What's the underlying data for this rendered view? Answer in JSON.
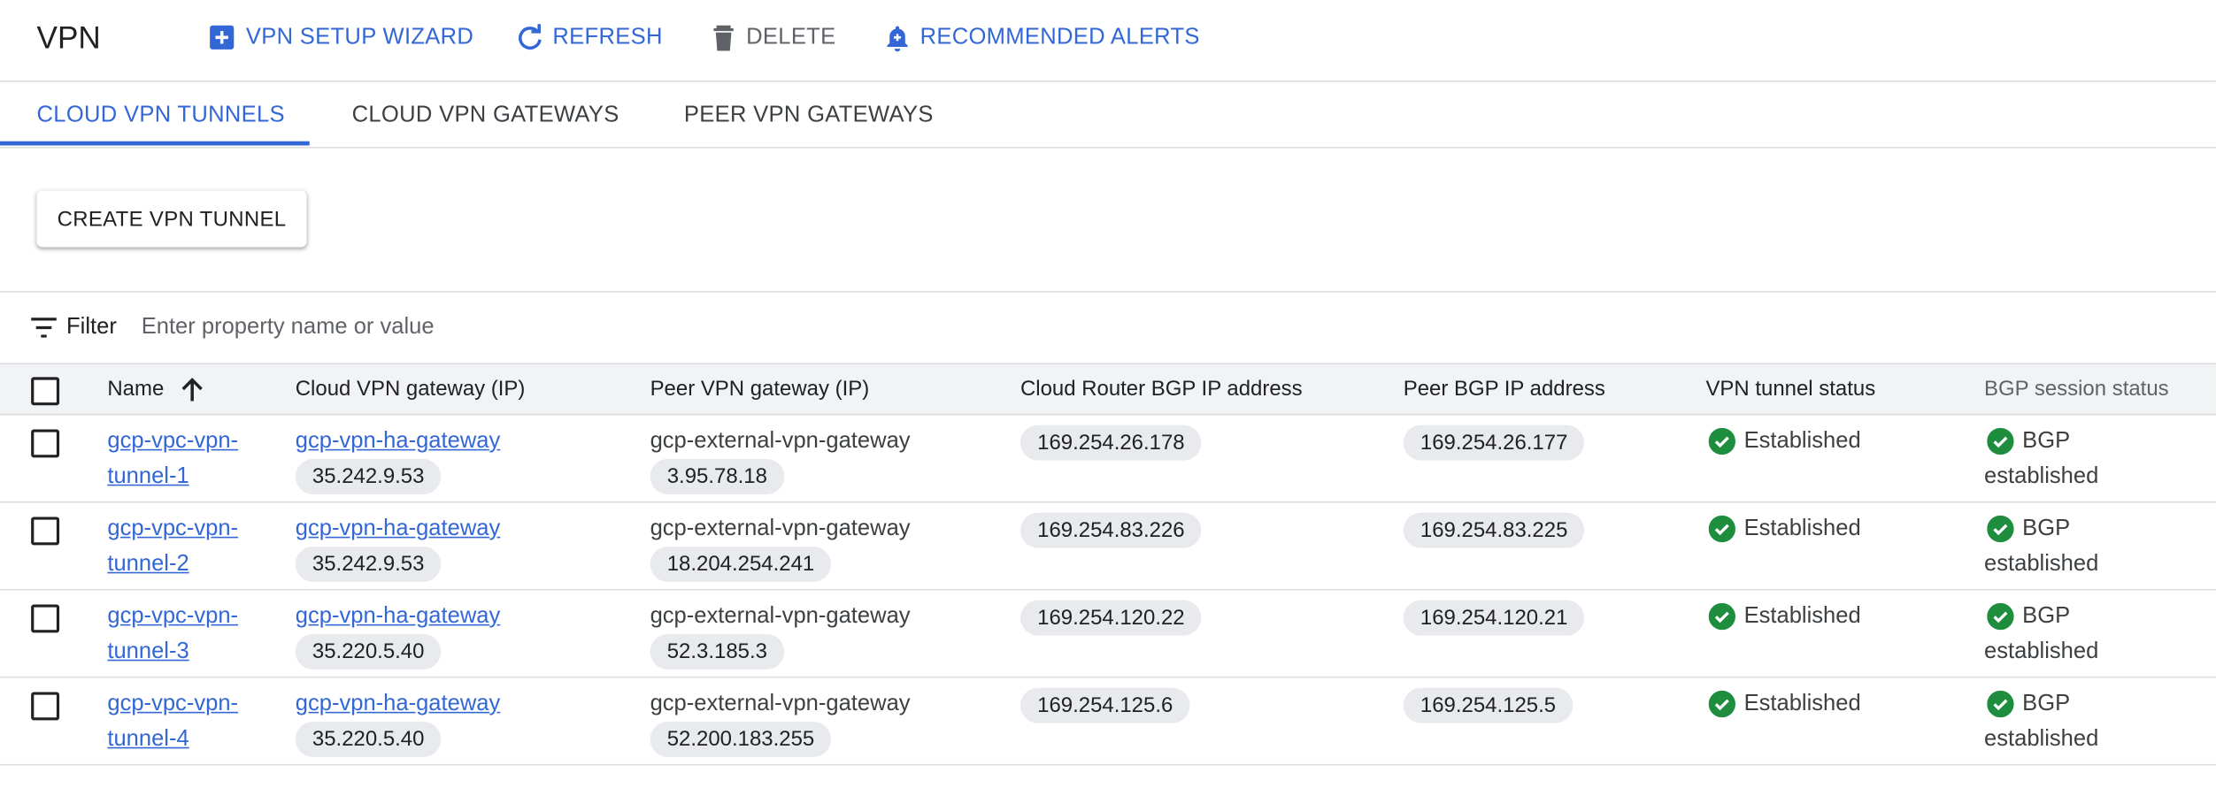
{
  "header": {
    "title": "VPN",
    "buttons": [
      {
        "label": "VPN SETUP WIZARD",
        "icon": "add-box-icon"
      },
      {
        "label": "REFRESH",
        "icon": "refresh-icon"
      },
      {
        "label": "DELETE",
        "icon": "trash-icon"
      },
      {
        "label": "RECOMMENDED ALERTS",
        "icon": "bell-icon"
      }
    ]
  },
  "tabs": [
    {
      "label": "CLOUD VPN TUNNELS",
      "active": true
    },
    {
      "label": "CLOUD VPN GATEWAYS",
      "active": false
    },
    {
      "label": "PEER VPN GATEWAYS",
      "active": false
    }
  ],
  "create_button": "CREATE VPN TUNNEL",
  "filter": {
    "label": "Filter",
    "placeholder": "Enter property name or value"
  },
  "table": {
    "columns": [
      "Name",
      "Cloud VPN gateway (IP)",
      "Peer VPN gateway (IP)",
      "Cloud Router BGP IP address",
      "Peer BGP IP address",
      "VPN tunnel status",
      "BGP session status"
    ],
    "rows": [
      {
        "name_line1": "gcp-vpc-vpn-",
        "name_line2": "tunnel-1",
        "cloud_gw": "gcp-vpn-ha-gateway",
        "cloud_ip": "35.242.9.53",
        "peer_gw": "gcp-external-vpn-gateway",
        "peer_ip": "3.95.78.18",
        "router_bgp": "169.254.26.178",
        "peer_bgp": "169.254.26.177",
        "tunnel_status": "Established",
        "bgp_line1": "BGP",
        "bgp_line2": "established"
      },
      {
        "name_line1": "gcp-vpc-vpn-",
        "name_line2": "tunnel-2",
        "cloud_gw": "gcp-vpn-ha-gateway",
        "cloud_ip": "35.242.9.53",
        "peer_gw": "gcp-external-vpn-gateway",
        "peer_ip": "18.204.254.241",
        "router_bgp": "169.254.83.226",
        "peer_bgp": "169.254.83.225",
        "tunnel_status": "Established",
        "bgp_line1": "BGP",
        "bgp_line2": "established"
      },
      {
        "name_line1": "gcp-vpc-vpn-",
        "name_line2": "tunnel-3",
        "cloud_gw": "gcp-vpn-ha-gateway",
        "cloud_ip": "35.220.5.40",
        "peer_gw": "gcp-external-vpn-gateway",
        "peer_ip": "52.3.185.3",
        "router_bgp": "169.254.120.22",
        "peer_bgp": "169.254.120.21",
        "tunnel_status": "Established",
        "bgp_line1": "BGP",
        "bgp_line2": "established"
      },
      {
        "name_line1": "gcp-vpc-vpn-",
        "name_line2": "tunnel-4",
        "cloud_gw": "gcp-vpn-ha-gateway",
        "cloud_ip": "35.220.5.40",
        "peer_gw": "gcp-external-vpn-gateway",
        "peer_ip": "52.200.183.255",
        "router_bgp": "169.254.125.6",
        "peer_bgp": "169.254.125.5",
        "tunnel_status": "Established",
        "bgp_line1": "BGP",
        "bgp_line2": "established"
      }
    ]
  },
  "colors": {
    "accent": "#3367d6",
    "success": "#1e8e3e",
    "chip": "#e8eaed"
  }
}
